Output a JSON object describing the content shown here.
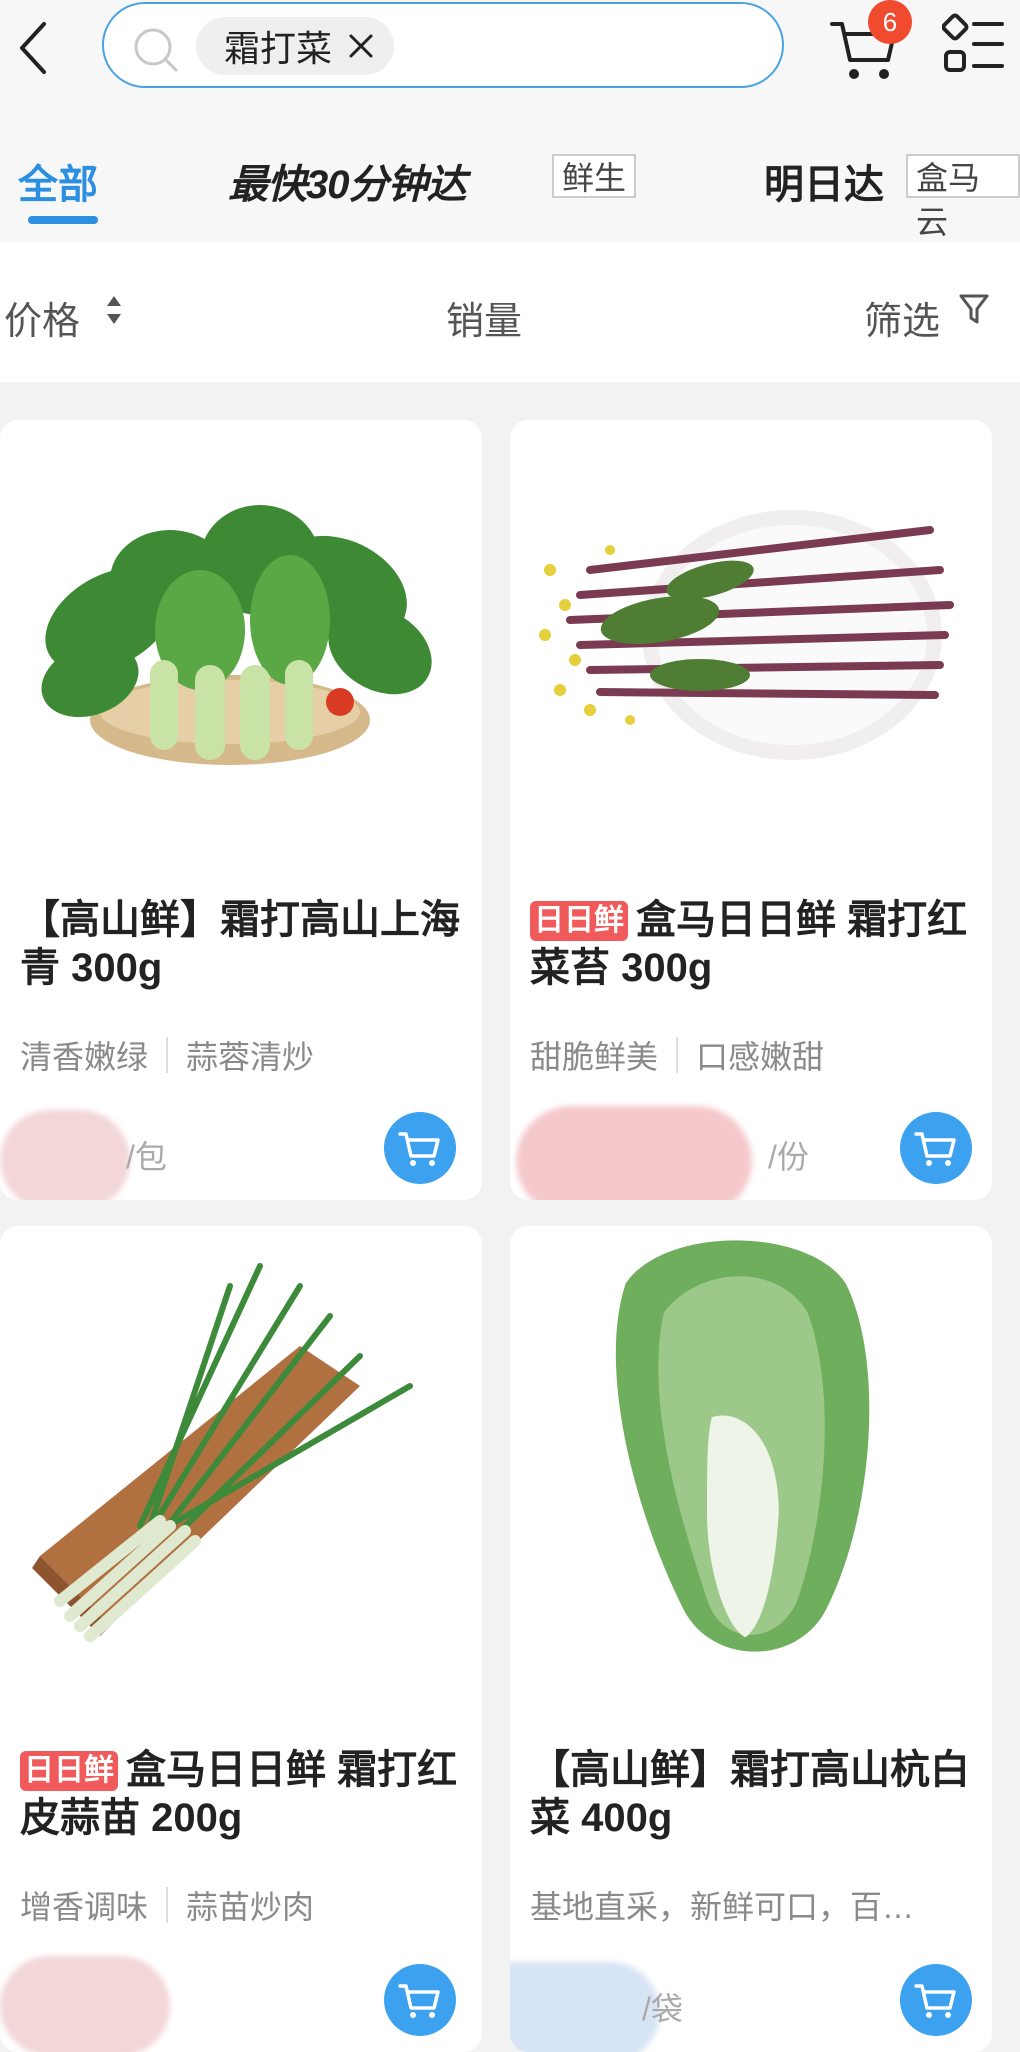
{
  "header": {
    "search_chip": "霜打菜",
    "cart_count": "6"
  },
  "tabs": {
    "all": "全部",
    "fast_delivery": "最快30分钟达",
    "fast_tag": "鲜生",
    "tomorrow": "明日达",
    "tomorrow_tag": "盒马云"
  },
  "sort": {
    "price": "价格",
    "sales": "销量",
    "filter": "筛选"
  },
  "products": [
    {
      "brand_tag": "",
      "title": "【高山鲜】霜打高山上海青 300g",
      "tags": [
        "清香嫩绿",
        "蒜蓉清炒"
      ],
      "unit": "/包"
    },
    {
      "brand_tag": "日日鲜",
      "title": "盒马日日鲜 霜打红菜苔 300g",
      "tags": [
        "甜脆鲜美",
        "口感嫩甜"
      ],
      "unit": "/份"
    },
    {
      "brand_tag": "日日鲜",
      "title": "盒马日日鲜 霜打红皮蒜苗 200g",
      "tags": [
        "增香调味",
        "蒜苗炒肉"
      ],
      "unit": ""
    },
    {
      "brand_tag": "",
      "title": "【高山鲜】霜打高山杭白菜 400g",
      "tags": [
        "基地直采，新鲜可口，百…"
      ],
      "unit": "/袋"
    }
  ],
  "icons": {
    "back": "chevron-left-icon",
    "search": "search-icon",
    "cart": "cart-icon",
    "menu": "list-menu-icon",
    "filter": "funnel-icon"
  },
  "colors": {
    "accent": "#2c8fe0",
    "badge": "#f04a2f",
    "cart_button": "#3ca1ee",
    "brand_tag": "#f05a5a"
  }
}
